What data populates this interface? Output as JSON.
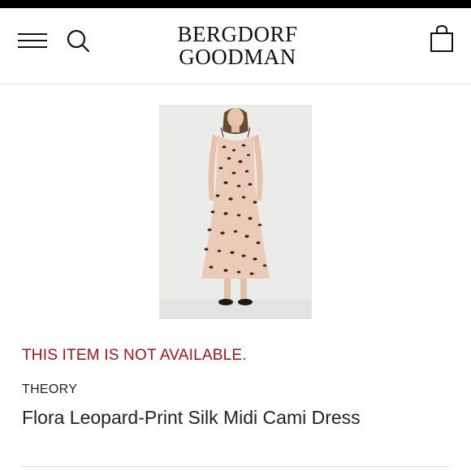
{
  "header": {
    "brand_line1": "BERGDORF",
    "brand_line2": "GOODMAN",
    "icons": [
      "menu-icon",
      "search-icon",
      "shopping-bag-icon"
    ]
  },
  "product": {
    "image_subject": "leopard-print silk midi cami dress on model",
    "availability_message": "THIS ITEM IS NOT AVAILABLE.",
    "brand": "THEORY",
    "name": "Flora Leopard-Print Silk Midi Cami Dress"
  },
  "colors": {
    "availability_text": "#a3121e",
    "text": "#222222",
    "top_strip": "#000000"
  }
}
